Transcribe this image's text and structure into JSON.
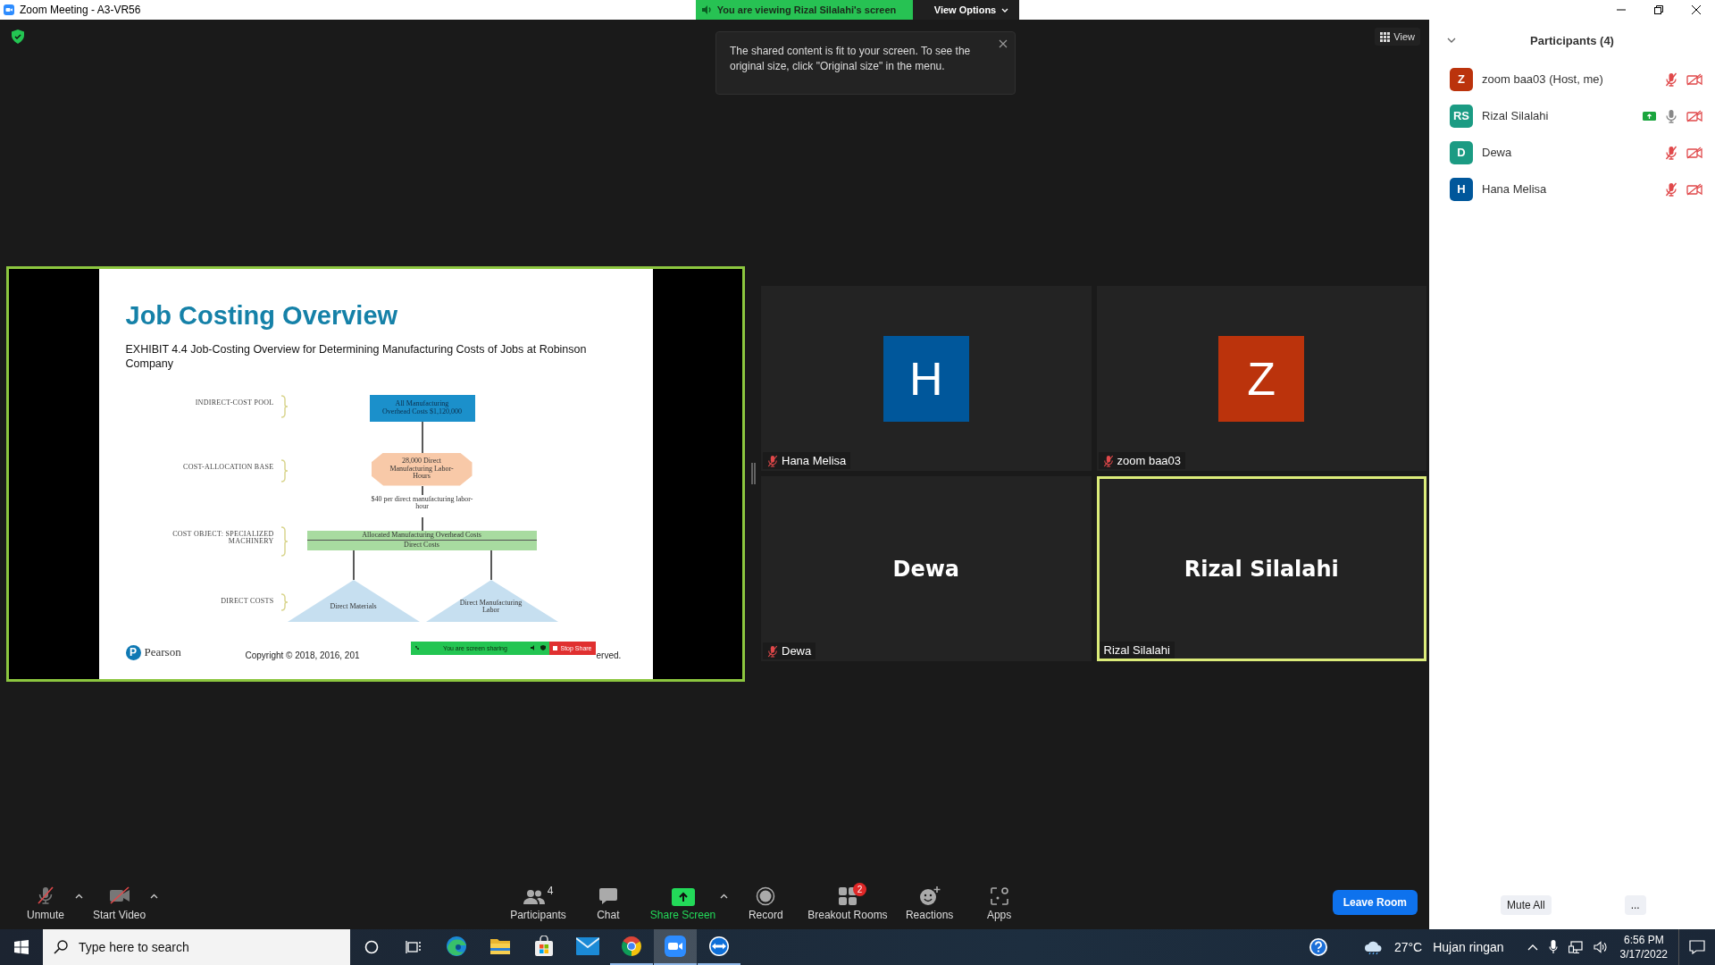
{
  "window": {
    "title": "Zoom Meeting - A3-VR56"
  },
  "share_banner": {
    "text": "You are viewing Rizal Silalahi's screen",
    "menu": "View Options"
  },
  "tooltip": {
    "text": "The shared content is fit to your screen. To see the original size, click \"Original size\" in the menu."
  },
  "view_button": {
    "label": "View"
  },
  "shared_screen": {
    "slide": {
      "title": "Job Costing Overview",
      "subtitle": "EXHIBIT 4.4 Job-Costing Overview for Determining Manufacturing Costs of Jobs at Robinson Company",
      "labels": [
        "INDIRECT-COST POOL",
        "COST-ALLOCATION BASE",
        "COST OBJECT: SPECIALIZED MACHINERY",
        "DIRECT COSTS"
      ],
      "pool": "All Manufacturing Overhead Costs $1,120,000",
      "base": "28,000 Direct Manufacturing Labor-Hours",
      "rate": "$40 per direct manufacturing labor-hour",
      "cost_object": [
        "Allocated Manufacturing Overhead Costs",
        "Direct Costs"
      ],
      "direct_costs": [
        "Direct Materials",
        "Direct Manufacturing Labor"
      ],
      "logo": {
        "mark": "P",
        "name": "Pearson"
      },
      "copyright_start": "Copyright © 2018, 2016, 201",
      "copyright_end": "erved."
    },
    "sharing_bar": {
      "text": "You are screen sharing",
      "stop": "Stop Share"
    }
  },
  "video_tiles": [
    {
      "kind": "avatar",
      "name": "Hana Melisa",
      "initial": "H",
      "color": "#00579b",
      "muted": true,
      "active": false
    },
    {
      "kind": "avatar",
      "name": "zoom baa03",
      "initial": "Z",
      "color": "#bb330c",
      "muted": true,
      "active": false
    },
    {
      "kind": "name",
      "name": "Dewa",
      "display_name": "Dewa",
      "muted": true,
      "active": false
    },
    {
      "kind": "name",
      "name": "Rizal Silalahi",
      "display_name": "Rizal Silalahi",
      "muted": false,
      "active": true
    }
  ],
  "toolbar": {
    "left": [
      {
        "kind": "mic",
        "label": "Unmute",
        "off": true,
        "menu": true
      },
      {
        "kind": "video",
        "label": "Start Video",
        "off": true,
        "menu": true
      }
    ],
    "center": [
      {
        "kind": "participants",
        "label": "Participants",
        "count": "4",
        "menu": false
      },
      {
        "kind": "chat",
        "label": "Chat",
        "menu": false
      },
      {
        "kind": "share",
        "label": "Share Screen",
        "menu": true
      },
      {
        "kind": "record",
        "label": "Record",
        "menu": false
      },
      {
        "kind": "breakout",
        "label": "Breakout Rooms",
        "badge": "2",
        "menu": false
      },
      {
        "kind": "reactions",
        "label": "Reactions",
        "menu": false
      },
      {
        "kind": "apps",
        "label": "Apps",
        "menu": false
      }
    ],
    "leave": "Leave Room"
  },
  "participants_panel": {
    "title": "Participants (4)",
    "participants": [
      {
        "name": "zoom baa03 (Host, me)",
        "initials": "Z",
        "color": "#bb330c",
        "muted": true,
        "video_off": true,
        "sharing": false
      },
      {
        "name": "Rizal Silalahi",
        "initials": "RS",
        "color": "#1b9b83",
        "muted": false,
        "video_off": true,
        "sharing": true
      },
      {
        "name": "Dewa",
        "initials": "D",
        "color": "#1b9b83",
        "muted": true,
        "video_off": true,
        "sharing": false
      },
      {
        "name": "Hana Melisa",
        "initials": "H",
        "color": "#00579b",
        "muted": true,
        "video_off": true,
        "sharing": false
      }
    ],
    "buttons": [
      "Mute All",
      "..."
    ]
  },
  "taskbar": {
    "search": {
      "placeholder": "Type here to search"
    },
    "apps": [
      {
        "kind": "edge",
        "running": false,
        "selected": false
      },
      {
        "kind": "explorer",
        "running": false,
        "selected": false
      },
      {
        "kind": "store",
        "running": false,
        "selected": false
      },
      {
        "kind": "mail",
        "running": false,
        "selected": false
      },
      {
        "kind": "chrome",
        "running": true,
        "selected": false
      },
      {
        "kind": "zoom",
        "running": true,
        "selected": true
      },
      {
        "kind": "teamviewer",
        "running": true,
        "selected": false
      }
    ],
    "weather": {
      "temperature": "27°C",
      "condition": "Hujan ringan"
    },
    "time": "6:56 PM",
    "date": "3/17/2022"
  }
}
